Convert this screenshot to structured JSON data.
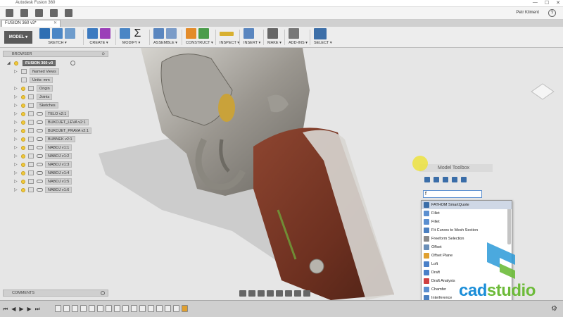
{
  "window": {
    "title": "Autodesk Fusion 360",
    "controls": [
      "—",
      "☐",
      "✕"
    ]
  },
  "quickbar": {
    "user_name": "Petr Kliment",
    "help": "?"
  },
  "document_tab": {
    "label": "FUSION 360 v3*",
    "close": "✕"
  },
  "toolbar": {
    "workspace_label": "MODEL ▾",
    "groups": [
      {
        "label": "SKETCH ▾"
      },
      {
        "label": "CREATE ▾"
      },
      {
        "label": "MODIFY ▾"
      },
      {
        "label": "ASSEMBLE ▾"
      },
      {
        "label": "CONSTRUCT ▾"
      },
      {
        "label": "INSPECT ▾"
      },
      {
        "label": "INSERT ▾"
      },
      {
        "label": "MAKE ▾"
      },
      {
        "label": "ADD-INS ▾"
      },
      {
        "label": "SELECT ▾"
      }
    ],
    "sigma": "Σ"
  },
  "browser": {
    "title": "BROWSER",
    "items": [
      {
        "label": "FUSION 360 v3"
      },
      {
        "label": "Named Views"
      },
      {
        "label": "Units: mm"
      },
      {
        "label": "Origin"
      },
      {
        "label": "Joints"
      },
      {
        "label": "Sketches"
      },
      {
        "label": "TELO v2:1"
      },
      {
        "label": "BUKOJET_LEVA v2:1"
      },
      {
        "label": "BUKOJET_PRAVA v2:1"
      },
      {
        "label": "BUBNEK v2:1"
      },
      {
        "label": "NABOJ v1:1"
      },
      {
        "label": "NABOJ v1:2"
      },
      {
        "label": "NABOJ v1:3"
      },
      {
        "label": "NABOJ v1:4"
      },
      {
        "label": "NABOJ v1:5"
      },
      {
        "label": "NABOJ v1:6"
      }
    ]
  },
  "model_toolbox": {
    "title": "Model Toolbox",
    "search_value": "f",
    "results": [
      {
        "label": "FATHOM SmartQuote",
        "icon_color": "#3a6da8"
      },
      {
        "label": "Fillet",
        "icon_color": "#5b8fd0"
      },
      {
        "label": "Fillet",
        "icon_color": "#5b8fd0"
      },
      {
        "label": "Fit Curves to Mesh Section",
        "icon_color": "#4a7fc0"
      },
      {
        "label": "Freeform Selection",
        "icon_color": "#8a8a8a"
      },
      {
        "label": "Offset",
        "icon_color": "#6a8fb8"
      },
      {
        "label": "Offset Plane",
        "icon_color": "#e0a030"
      },
      {
        "label": "Loft",
        "icon_color": "#4a80c8"
      },
      {
        "label": "Draft",
        "icon_color": "#4a80c8"
      },
      {
        "label": "Draft Analysis",
        "icon_color": "#d04040"
      },
      {
        "label": "Chamfer",
        "icon_color": "#5b8fd0"
      },
      {
        "label": "Interference",
        "icon_color": "#4a7fc0"
      }
    ]
  },
  "comments": {
    "title": "COMMENTS"
  },
  "timeline": {
    "controls": [
      "⏮",
      "◀",
      "▶",
      "▶",
      "⏭"
    ],
    "settings": "⚙"
  },
  "logo": {
    "part1": "cad",
    "part2": "studio"
  },
  "colors": {
    "accent": "#1b8ed8",
    "logo_green": "#6dbb3a",
    "cursor_highlight": "#ece23e"
  }
}
